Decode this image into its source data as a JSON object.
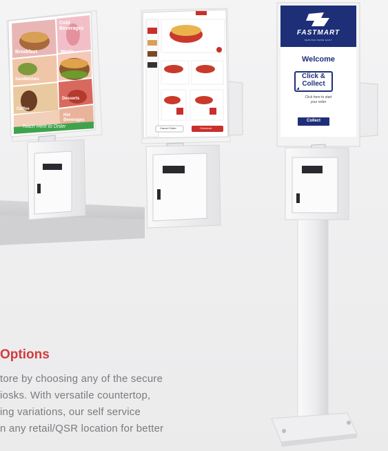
{
  "section": {
    "title": "Options",
    "lines": [
      "tore by choosing any of the secure",
      "iosks. With versatile countertop,",
      "ing variations, our self service",
      "n any retail/QSR location for better"
    ]
  },
  "kiosk_left": {
    "tiles": [
      "Cold Beverages",
      "Breakfast",
      "Meals",
      "Sandwiches",
      "Desserts",
      "Coffee",
      "Hot Beverages"
    ],
    "cta": "Touch Here to Order"
  },
  "kiosk_center": {
    "buttons": [
      "Cancel Order",
      "Checkout"
    ]
  },
  "kiosk_right": {
    "brand": "FASTMART",
    "tagline": "SERVING MADE EASY",
    "welcome": "Welcome",
    "badge_line1": "Click &",
    "badge_line2": "Collect",
    "hint_line1": "Click here to start",
    "hint_line2": "your order",
    "button": "Collect"
  },
  "colors": {
    "accent_red": "#d23c3c",
    "navy": "#1e2f78",
    "green": "#3fa34d",
    "kiosk_white": "#f7f7f8"
  }
}
